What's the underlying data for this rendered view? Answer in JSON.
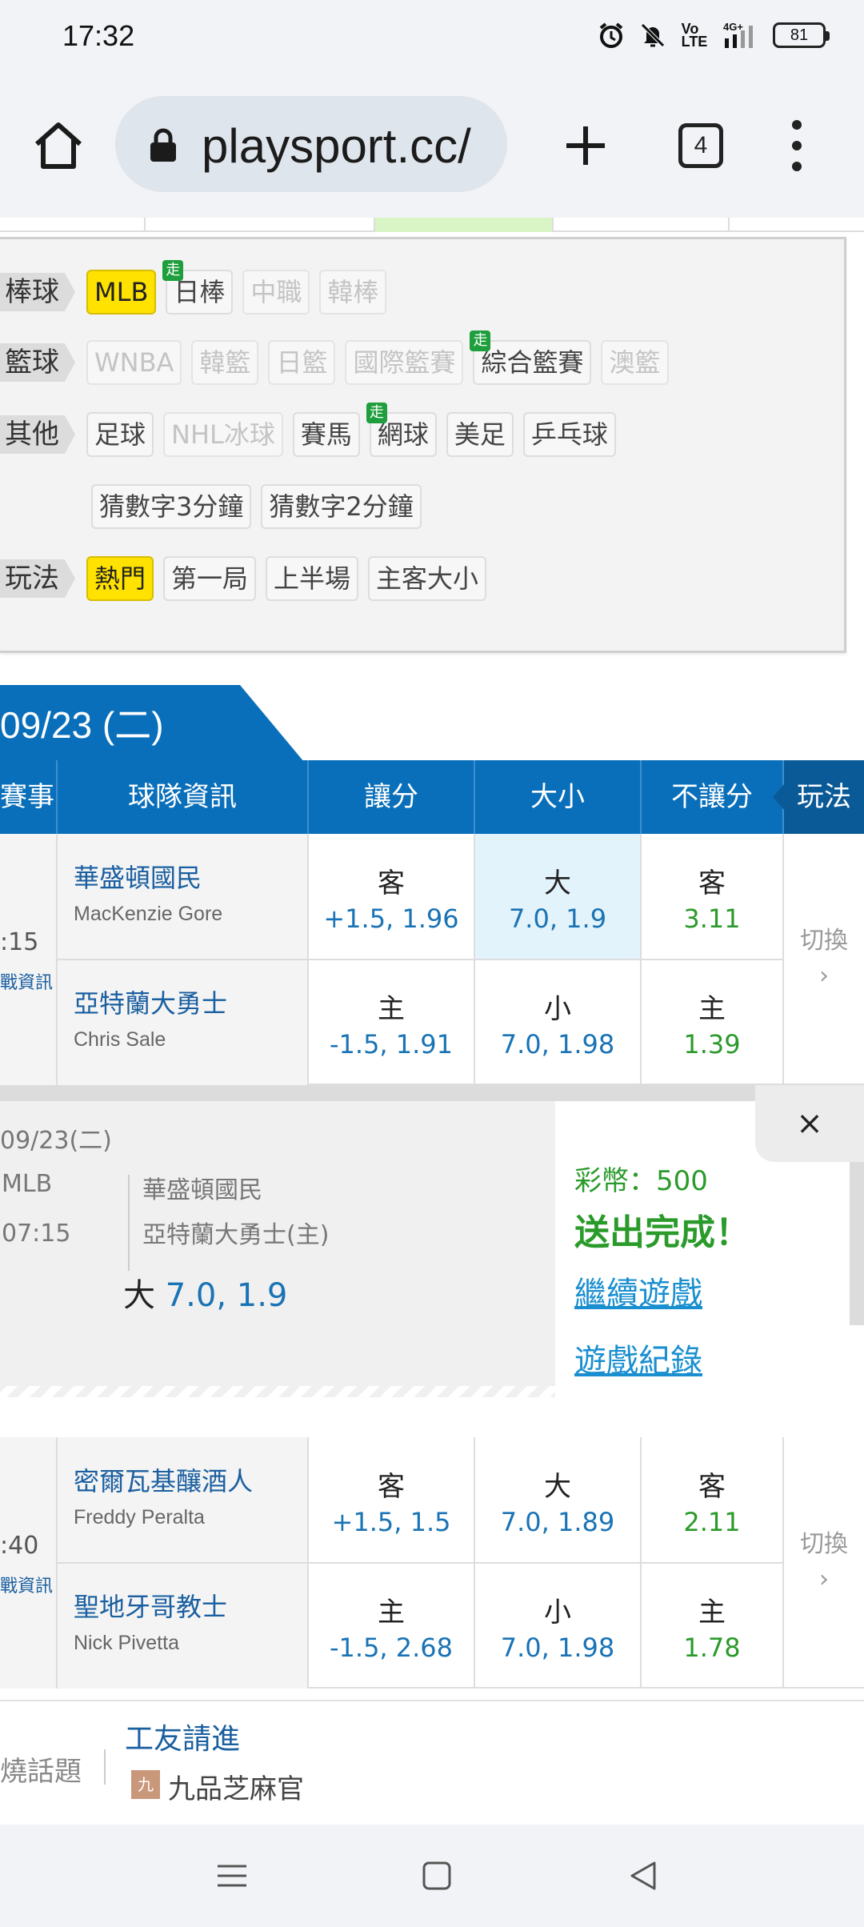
{
  "status_bar": {
    "time": "17:32",
    "volte": "Vo\nLTE",
    "network": "4G+",
    "battery": "81"
  },
  "browser": {
    "url": "playsport.cc/",
    "tab_count": "4"
  },
  "filters": {
    "rows": [
      {
        "head": "棒球",
        "chips": [
          {
            "label": "MLB",
            "state": "on"
          },
          {
            "label": "日棒",
            "state": "normal",
            "walk": "走"
          },
          {
            "label": "中職",
            "state": "dim"
          },
          {
            "label": "韓棒",
            "state": "dim"
          }
        ]
      },
      {
        "head": "籃球",
        "chips": [
          {
            "label": "WNBA",
            "state": "dim"
          },
          {
            "label": "韓籃",
            "state": "dim"
          },
          {
            "label": "日籃",
            "state": "dim"
          },
          {
            "label": "國際籃賽",
            "state": "dim"
          },
          {
            "label": "綜合籃賽",
            "state": "normal",
            "walk": "走"
          },
          {
            "label": "澳籃",
            "state": "dim"
          }
        ]
      },
      {
        "head": "其他",
        "chips": [
          {
            "label": "足球",
            "state": "normal"
          },
          {
            "label": "NHL冰球",
            "state": "dim"
          },
          {
            "label": "賽馬",
            "state": "normal"
          },
          {
            "label": "網球",
            "state": "normal",
            "walk": "走"
          },
          {
            "label": "美足",
            "state": "normal"
          },
          {
            "label": "乒乓球",
            "state": "normal"
          }
        ]
      },
      {
        "head": "",
        "chips": [
          {
            "label": "猜數字3分鐘",
            "state": "normal"
          },
          {
            "label": "猜數字2分鐘",
            "state": "normal"
          }
        ]
      },
      {
        "head": "玩法",
        "chips": [
          {
            "label": "熱門",
            "state": "on"
          },
          {
            "label": "第一局",
            "state": "normal"
          },
          {
            "label": "上半場",
            "state": "normal"
          },
          {
            "label": "主客大小",
            "state": "normal"
          }
        ]
      }
    ]
  },
  "date_tab": "09/23 (二)",
  "table_headers": {
    "event": "賽事",
    "team_info": "球隊資訊",
    "spread": "讓分",
    "total": "大小",
    "moneyline": "不讓分",
    "play": "玩法"
  },
  "games": [
    {
      "time": ":15",
      "info": "戰資訊",
      "switch": "切換",
      "away": {
        "team": "華盛頓國民",
        "pitcher": "MacKenzie Gore",
        "spread_lb": "客",
        "spread": "+1.5, 1.96",
        "total_lb": "大",
        "total": "7.0, 1.9",
        "ml_lb": "客",
        "ml": "3.11"
      },
      "home": {
        "team": "亞特蘭大勇士",
        "pitcher": "Chris Sale",
        "spread_lb": "主",
        "spread": "-1.5, 1.91",
        "total_lb": "小",
        "total": "7.0, 1.98",
        "ml_lb": "主",
        "ml": "1.39"
      }
    },
    {
      "time": ":40",
      "info": "戰資訊",
      "switch": "切換",
      "away": {
        "team": "密爾瓦基釀酒人",
        "pitcher": "Freddy Peralta",
        "spread_lb": "客",
        "spread": "+1.5, 1.5",
        "total_lb": "大",
        "total": "7.0, 1.89",
        "ml_lb": "客",
        "ml": "2.11"
      },
      "home": {
        "team": "聖地牙哥教士",
        "pitcher": "Nick Pivetta",
        "spread_lb": "主",
        "spread": "-1.5, 2.68",
        "total_lb": "小",
        "total": "7.0, 1.98",
        "ml_lb": "主",
        "ml": "1.78"
      }
    }
  ],
  "ticket": {
    "date": "09/23(二)",
    "league": "MLB",
    "time": "07:15",
    "away": "華盛頓國民",
    "home": "亞特蘭大勇士(主)",
    "pick_lb": "大",
    "pick_val": "7.0, 1.9",
    "coins": "彩幣：500",
    "done": "送出完成！",
    "continue": "繼續遊戲",
    "record": "遊戲紀錄",
    "close": "×"
  },
  "news": {
    "left": "燒話題",
    "title": "工友請進",
    "avatar": "九",
    "author": "九品芝麻官"
  },
  "colors": {
    "brand_blue": "#0a6fba",
    "highlight_yellow": "#ffe200",
    "odds_green": "#2a9a2a",
    "odds_blue": "#1973b5"
  }
}
